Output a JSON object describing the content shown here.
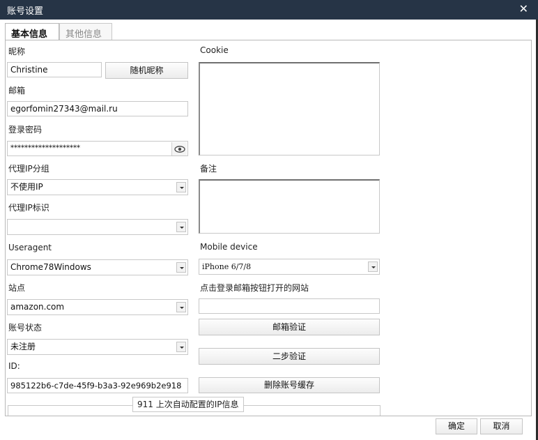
{
  "window": {
    "title": "账号设置",
    "close_glyph": "✕"
  },
  "tabs": [
    {
      "label": "基本信息",
      "active": true
    },
    {
      "label": "其他信息",
      "active": false
    }
  ],
  "left": {
    "nickname": {
      "label": "昵称",
      "value": "Christine",
      "random_button": "随机昵称"
    },
    "email": {
      "label": "邮箱",
      "value": "egorfomin27343@mail.ru"
    },
    "password": {
      "label": "登录密码",
      "value": "********************",
      "toggle_icon": "eye-icon"
    },
    "proxy_group": {
      "label": "代理IP分组",
      "value": "不使用IP"
    },
    "proxy_tag": {
      "label": "代理IP标识",
      "value": ""
    },
    "useragent": {
      "label": "Useragent",
      "value": "Chrome78Windows"
    },
    "site": {
      "label": "站点",
      "value": "amazon.com"
    },
    "account_status": {
      "label": "账号状态",
      "value": "未注册"
    },
    "id": {
      "label": "ID:",
      "value": "985122b6-c7de-45f9-b3a3-92e969b2e918"
    }
  },
  "right": {
    "cookie": {
      "label": "Cookie",
      "value": ""
    },
    "remark": {
      "label": "备注",
      "value": ""
    },
    "mobile_device": {
      "label": "Mobile device",
      "value": "iPhone 6/7/8"
    },
    "login_site": {
      "label": "点击登录邮箱按钮打开的网站",
      "value": ""
    },
    "buttons": {
      "email_verify": "邮箱验证",
      "two_step": "二步验证",
      "delete_cache": "删除账号缓存"
    }
  },
  "ip_group": {
    "legend": "911 上次自动配置的IP信息"
  },
  "footer": {
    "ok": "确定",
    "cancel": "取消"
  },
  "colors": {
    "titlebar": "#263446",
    "border": "#c8c8c8"
  }
}
